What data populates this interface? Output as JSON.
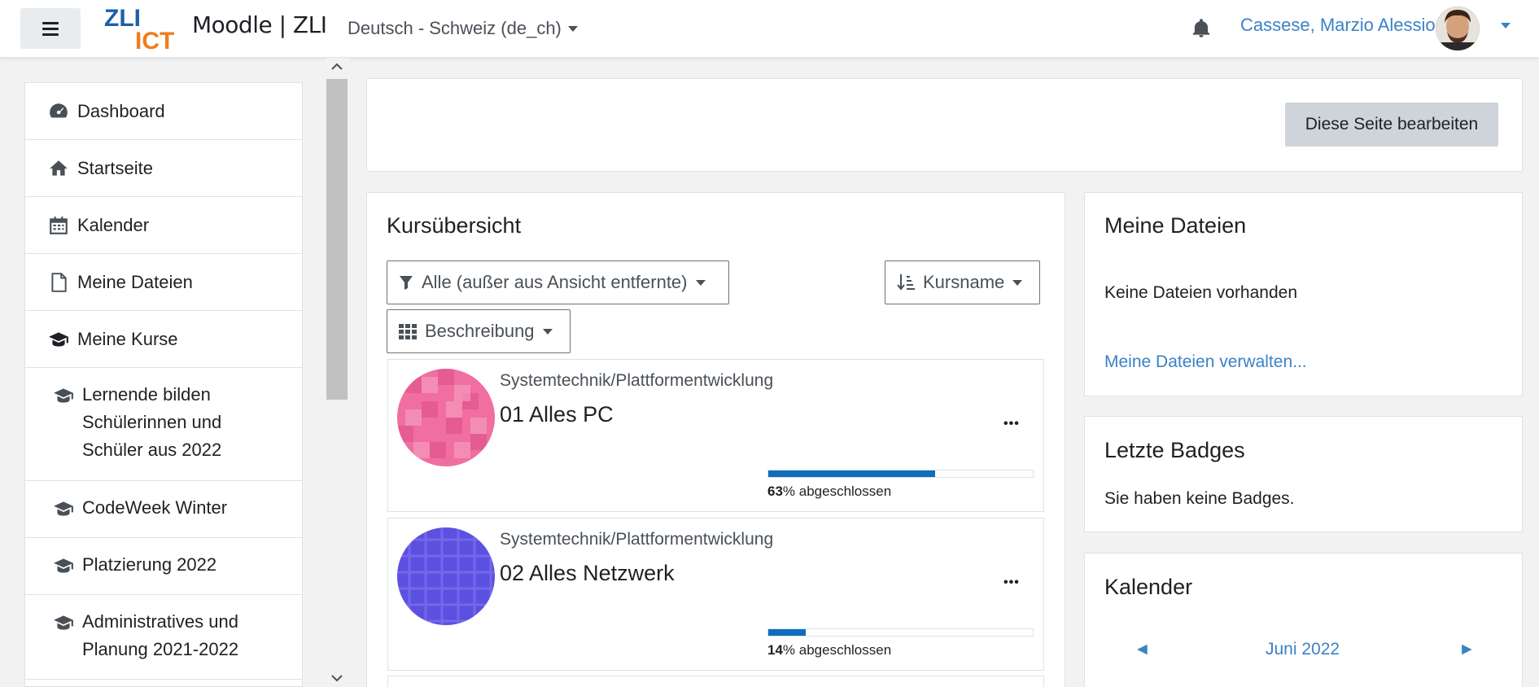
{
  "header": {
    "site_name": "Moodle | ZLI",
    "logo_text_top": "ZLI",
    "logo_text_bottom": "ICT",
    "language": "Deutsch - Schweiz (de_ch)",
    "user_name": "Cassese, Marzio Alessio"
  },
  "drawer": {
    "items": [
      {
        "label": "Dashboard",
        "icon": "dashboard-icon"
      },
      {
        "label": "Startseite",
        "icon": "home-icon"
      },
      {
        "label": "Kalender",
        "icon": "calendar-icon"
      },
      {
        "label": "Meine Dateien",
        "icon": "file-icon"
      },
      {
        "label": "Meine Kurse",
        "icon": "graduation-cap-icon"
      }
    ],
    "courses": [
      {
        "label": "Lernende bilden Schülerinnen und Schüler aus 2022"
      },
      {
        "label": "CodeWeek Winter"
      },
      {
        "label": "Platzierung 2022"
      },
      {
        "label": "Administratives und Planung 2021-2022"
      }
    ]
  },
  "page": {
    "edit_button": "Diese Seite bearbeiten"
  },
  "course_overview": {
    "title": "Kursübersicht",
    "filter": "Alle (außer aus Ansicht entfernte)",
    "sort": "Kursname",
    "view": "Beschreibung",
    "courses": [
      {
        "category": "Systemtechnik/Plattformentwicklung",
        "name": "01 Alles PC",
        "progress": 63,
        "progress_label": "% abgeschlossen",
        "color": "#f06ea0"
      },
      {
        "category": "Systemtechnik/Plattformentwicklung",
        "name": "02 Alles Netzwerk",
        "progress": 14,
        "progress_label": "% abgeschlossen",
        "color": "#5b50e0"
      }
    ]
  },
  "my_files": {
    "title": "Meine Dateien",
    "empty_text": "Keine Dateien vorhanden",
    "manage_link": "Meine Dateien verwalten..."
  },
  "badges": {
    "title": "Letzte Badges",
    "empty_text": "Sie haben keine Badges."
  },
  "calendar": {
    "title": "Kalender",
    "month": "Juni 2022",
    "prev": "◄",
    "next": "►"
  },
  "colors": {
    "accent": "#3b82c4",
    "progress": "#0f6cbf"
  }
}
